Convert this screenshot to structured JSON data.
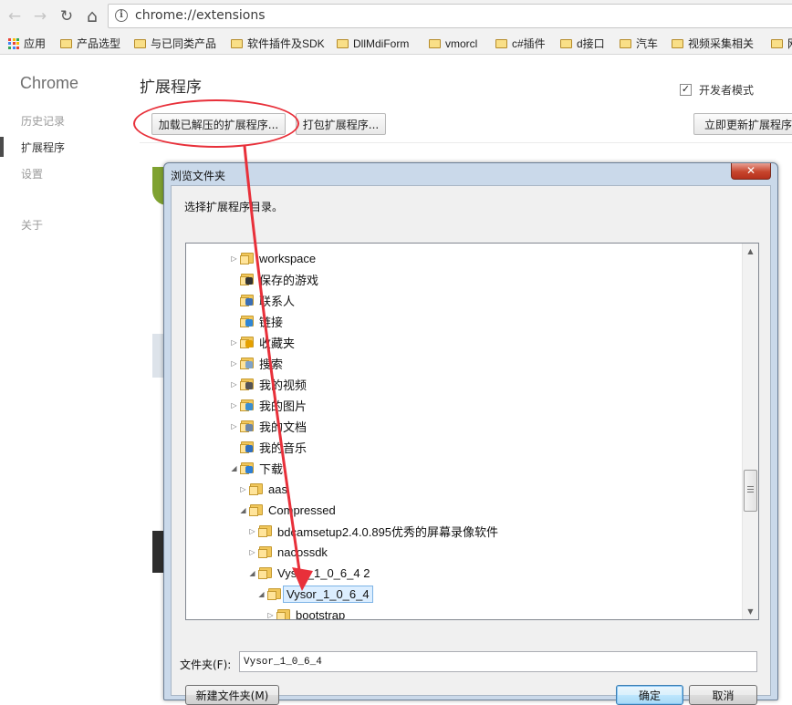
{
  "browser": {
    "url": "chrome://extensions",
    "nav": {
      "back": "←",
      "forward": "→",
      "reload": "↻",
      "home": "⌂",
      "info": "i"
    }
  },
  "bookmarks": [
    {
      "label": "应用",
      "icon": "apps-grid-icon"
    },
    {
      "label": "产品选型",
      "icon": "folder-icon"
    },
    {
      "label": "与已同类产品",
      "icon": "folder-icon"
    },
    {
      "label": "软件插件及SDK",
      "icon": "folder-icon"
    },
    {
      "label": "DllMdiForm",
      "icon": "folder-icon"
    },
    {
      "label": "vmorcl",
      "icon": "folder-icon"
    },
    {
      "label": "c#插件",
      "icon": "folder-icon"
    },
    {
      "label": "d接口",
      "icon": "folder-icon"
    },
    {
      "label": "汽车",
      "icon": "folder-icon"
    },
    {
      "label": "视频采集相关",
      "icon": "folder-icon"
    },
    {
      "label": "网",
      "icon": "folder-icon"
    }
  ],
  "page": {
    "sidebar_title": "Chrome",
    "sidebar_items": [
      "历史记录",
      "扩展程序",
      "设置",
      "关于"
    ],
    "active_item": "扩展程序",
    "heading": "扩展程序",
    "developer_mode_label": "开发者模式",
    "developer_mode_checked": true,
    "developer_mode_check": "✓",
    "buttons": {
      "load_unpacked": "加载已解压的扩展程序...",
      "pack": "打包扩展程序...",
      "update_now": "立即更新扩展程序"
    }
  },
  "dialog": {
    "title": "浏览文件夹",
    "close": "✕",
    "prompt": "选择扩展程序目录。",
    "tree": [
      {
        "label": "workspace",
        "depth": 0,
        "expander": "▷",
        "icon": "folder-icon"
      },
      {
        "label": "保存的游戏",
        "depth": 0,
        "expander": "",
        "icon": "saved-games-folder-icon"
      },
      {
        "label": "联系人",
        "depth": 0,
        "expander": "",
        "icon": "contacts-folder-icon"
      },
      {
        "label": "链接",
        "depth": 0,
        "expander": "",
        "icon": "links-folder-icon"
      },
      {
        "label": "收藏夹",
        "depth": 0,
        "expander": "▷",
        "icon": "favorites-folder-icon"
      },
      {
        "label": "搜索",
        "depth": 0,
        "expander": "▷",
        "icon": "searches-folder-icon"
      },
      {
        "label": "我的视频",
        "depth": 0,
        "expander": "▷",
        "icon": "videos-folder-icon"
      },
      {
        "label": "我的图片",
        "depth": 0,
        "expander": "▷",
        "icon": "pictures-folder-icon"
      },
      {
        "label": "我的文档",
        "depth": 0,
        "expander": "▷",
        "icon": "documents-folder-icon"
      },
      {
        "label": "我的音乐",
        "depth": 0,
        "expander": "",
        "icon": "music-folder-icon"
      },
      {
        "label": "下载",
        "depth": 0,
        "expander": "◢",
        "icon": "downloads-folder-icon"
      },
      {
        "label": "aas",
        "depth": 1,
        "expander": "▷",
        "icon": "folder-icon"
      },
      {
        "label": "Compressed",
        "depth": 1,
        "expander": "◢",
        "icon": "folder-icon"
      },
      {
        "label": "bdcamsetup2.4.0.895优秀的屏幕录像软件",
        "depth": 2,
        "expander": "▷",
        "icon": "folder-icon"
      },
      {
        "label": "nacossdk",
        "depth": 2,
        "expander": "▷",
        "icon": "folder-icon"
      },
      {
        "label": "Vysor_1_0_6_4 2",
        "depth": 2,
        "expander": "◢",
        "icon": "folder-icon"
      },
      {
        "label": "Vysor_1_0_6_4",
        "depth": 3,
        "expander": "◢",
        "icon": "folder-icon",
        "selected": true
      },
      {
        "label": "bootstrap",
        "depth": 4,
        "expander": "▷",
        "icon": "folder-icon"
      }
    ],
    "scroll": {
      "up": "▲",
      "down": "▼",
      "position": 0.6
    },
    "folder_label": "文件夹(F):",
    "folder_value": "Vysor_1_0_6_4",
    "buttons": {
      "new_folder": "新建文件夹(M)",
      "ok": "确定",
      "cancel": "取消"
    }
  },
  "colors": {
    "annotation_red": "#e8303a",
    "dialog_frame": "#cad9ea",
    "selection": "#dceeff"
  }
}
